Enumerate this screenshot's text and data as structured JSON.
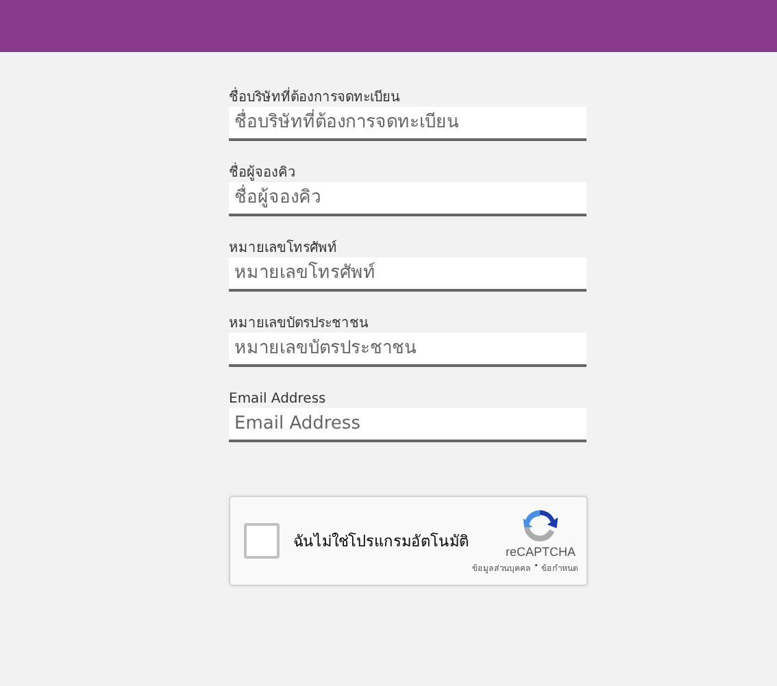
{
  "fields": [
    {
      "label": "ชื่อบริษัทที่ต้องการจดทะเบียน",
      "placeholder": "ชื่อบริษัทที่ต้องการจดทะเบียน"
    },
    {
      "label": "ชื่อผู้จองคิว",
      "placeholder": "ชื่อผู้จองคิว"
    },
    {
      "label": "หมายเลขโทรศัพท์",
      "placeholder": "หมายเลขโทรศัพท์"
    },
    {
      "label": "หมายเลขบัตรประชาชน",
      "placeholder": "หมายเลขบัตรประชาชน"
    },
    {
      "label": "Email Address",
      "placeholder": "Email Address"
    }
  ],
  "captcha": {
    "checked": false,
    "label": "ฉันไม่ใช่โปรแกรมอัตโนมัติ",
    "brand": "reCAPTCHA",
    "privacy": "ข้อมูลส่วนบุคคล",
    "separator": "•",
    "terms": "ข้อกำหนด"
  }
}
